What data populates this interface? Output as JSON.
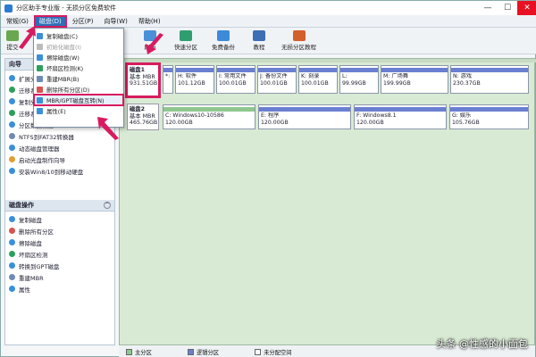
{
  "window": {
    "title": "分区助手专业版 - 无损分区免费软件",
    "min": "—",
    "max": "☐",
    "close": "✕"
  },
  "menubar": {
    "items": [
      "常规(G)",
      "磁盘(D)",
      "分区(P)",
      "向导(W)",
      "帮助(H)"
    ]
  },
  "toolbar": {
    "left_partial": "提交",
    "buttons": [
      "刷新",
      "快速分区",
      "免费备份",
      "教程",
      "无损分区教程"
    ]
  },
  "dropdown": {
    "items": [
      {
        "label": "复制磁盘(C)",
        "disabled": false
      },
      {
        "label": "初始化磁盘(I)",
        "disabled": true
      },
      {
        "label": "擦除磁盘(W)",
        "disabled": false
      },
      {
        "label": "坏扇区检测(K)",
        "disabled": false
      },
      {
        "label": "重建MBR(B)",
        "disabled": false
      },
      {
        "label": "删除所有分区(D)",
        "disabled": false
      },
      {
        "label": "MBR/GPT磁盘互转(N)",
        "disabled": false
      },
      {
        "label": "属性(E)",
        "disabled": false
      }
    ]
  },
  "sidebar": {
    "wizard_title": "向导",
    "wizard_items": [
      "扩展分区向导",
      "迁移系统到固态硬盘",
      "复制分区向导",
      "迁移系统到其他盘",
      "分区数据恢复",
      "NTFS到FAT32转换器",
      "动态磁盘管理器",
      "启动光盘制作向导",
      "安装Win8/10到移动硬盘"
    ],
    "ops_title": "磁盘操作",
    "ops_items": [
      "复制磁盘",
      "删除所有分区",
      "擦除磁盘",
      "坏扇区检测",
      "转换到GPT磁盘",
      "重建MBR",
      "属性"
    ]
  },
  "disk1": {
    "name": "磁盘1",
    "type": "基本 MBR",
    "size": "931.51GB",
    "partitions": [
      {
        "label": "*:",
        "size": "",
        "fs": ""
      },
      {
        "label": "H: 软件",
        "size": "101.12GB",
        "fs": "NTFS"
      },
      {
        "label": "I: 常用文件",
        "size": "100.01GB",
        "fs": "NTFS"
      },
      {
        "label": "J: 备份文件",
        "size": "100.01GB",
        "fs": "NTFS"
      },
      {
        "label": "K: 刻录",
        "size": "100.01GB",
        "fs": "NTFS"
      },
      {
        "label": "L:",
        "size": "99.99GB",
        "fs": "NTFS"
      },
      {
        "label": "M: 广场舞",
        "size": "199.99GB",
        "fs": "NTFS"
      },
      {
        "label": "N: 游戏",
        "size": "230.37GB",
        "fs": "NTFS"
      }
    ]
  },
  "disk2": {
    "name": "磁盘2",
    "type": "基本 MBR",
    "size": "465.76GB",
    "partitions": [
      {
        "label": "C: Windows10-10586",
        "size": "120.00GB",
        "fs": "NTFS"
      },
      {
        "label": "E: 程序",
        "size": "120.00GB",
        "fs": "NTFS"
      },
      {
        "label": "F: Windows8.1",
        "size": "120.00GB",
        "fs": "NTFS"
      },
      {
        "label": "G: 娱乐",
        "size": "105.76GB",
        "fs": "NTFS"
      }
    ]
  },
  "legend": [
    "主分区",
    "逻辑分区",
    "未分配空间"
  ],
  "watermark": "头条 @性感的小面包",
  "colors": {
    "primary_bar": "#8fc78f",
    "logical_bar": "#6b7fd1",
    "highlight": "#d81b60",
    "menu_active": "#2f6fb8"
  }
}
